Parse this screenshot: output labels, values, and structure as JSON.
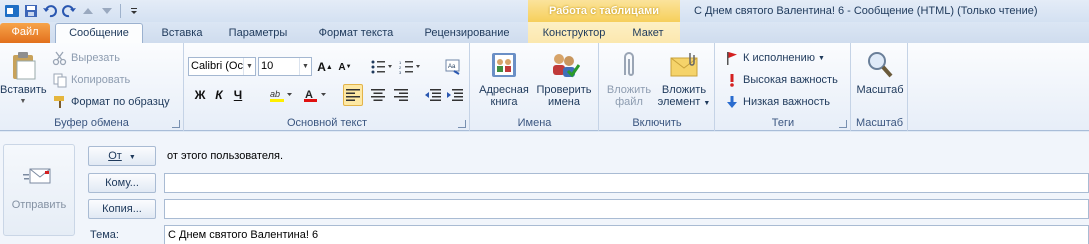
{
  "titlebar": {
    "context_title": "Работа с таблицами",
    "window_title": "С Днем святого Валентина! 6  -  Сообщение (HTML) (Только чтение)"
  },
  "tabs": [
    {
      "label": "Файл"
    },
    {
      "label": "Сообщение"
    },
    {
      "label": "Вставка"
    },
    {
      "label": "Параметры"
    },
    {
      "label": "Формат текста"
    },
    {
      "label": "Рецензирование"
    },
    {
      "label": "Конструктор"
    },
    {
      "label": "Макет"
    }
  ],
  "clipboard": {
    "paste": "Вставить",
    "cut": "Вырезать",
    "copy": "Копировать",
    "format_painter": "Формат по образцу",
    "label": "Буфер обмена"
  },
  "basic_text": {
    "font": "Calibri (Ос",
    "size": "10",
    "bold": "Ж",
    "italic": "К",
    "underline": "Ч",
    "label": "Основной текст"
  },
  "names": {
    "address_book": "Адресная книга",
    "check_names": "Проверить имена",
    "label": "Имена"
  },
  "include": {
    "attach_file": "Вложить файл",
    "attach_item": "Вложить элемент",
    "label": "Включить"
  },
  "tags": {
    "followup": "К исполнению",
    "high": "Высокая важность",
    "low": "Низкая важность",
    "label": "Теги"
  },
  "zoom": {
    "button": "Масштаб",
    "label": "Масштаб"
  },
  "compose": {
    "send": "Отправить",
    "from_button": "От",
    "from_value": "от этого пользователя.",
    "to_button": "Кому...",
    "cc_button": "Копия...",
    "subject_label": "Тема:",
    "subject_value": "С Днем святого Валентина! 6"
  },
  "colors": {
    "file_tab": "#e2701d",
    "context_tab": "#f6cf5b",
    "ribbon_bg": "#e7eef8"
  }
}
